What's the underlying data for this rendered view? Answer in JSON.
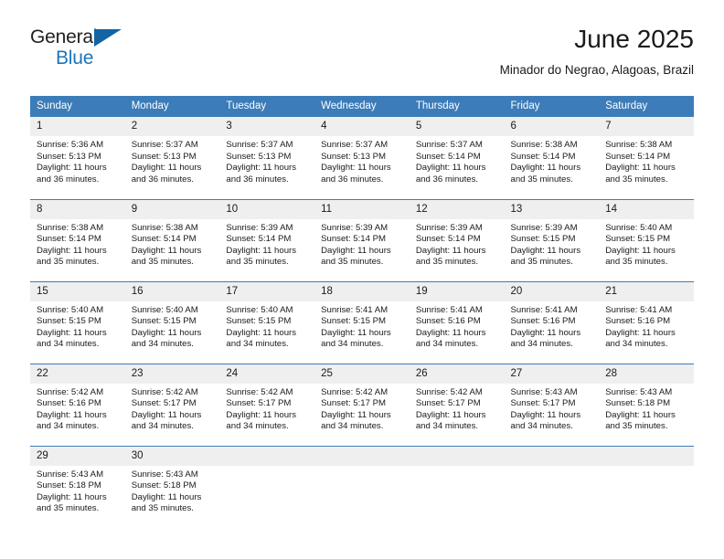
{
  "brand": {
    "line1": "General",
    "line2": "Blue",
    "triangle_color": "#1264a4",
    "blue_text_color": "#1b75bc"
  },
  "header": {
    "title": "June 2025",
    "subtitle": "Minador do Negrao, Alagoas, Brazil",
    "accent_color": "#3c7cb8",
    "daynum_bg": "#efefef"
  },
  "weekday_headers": [
    "Sunday",
    "Monday",
    "Tuesday",
    "Wednesday",
    "Thursday",
    "Friday",
    "Saturday"
  ],
  "weeks": [
    [
      {
        "day": "1",
        "sunrise": "Sunrise: 5:36 AM",
        "sunset": "Sunset: 5:13 PM",
        "daylight_l1": "Daylight: 11 hours",
        "daylight_l2": "and 36 minutes."
      },
      {
        "day": "2",
        "sunrise": "Sunrise: 5:37 AM",
        "sunset": "Sunset: 5:13 PM",
        "daylight_l1": "Daylight: 11 hours",
        "daylight_l2": "and 36 minutes."
      },
      {
        "day": "3",
        "sunrise": "Sunrise: 5:37 AM",
        "sunset": "Sunset: 5:13 PM",
        "daylight_l1": "Daylight: 11 hours",
        "daylight_l2": "and 36 minutes."
      },
      {
        "day": "4",
        "sunrise": "Sunrise: 5:37 AM",
        "sunset": "Sunset: 5:13 PM",
        "daylight_l1": "Daylight: 11 hours",
        "daylight_l2": "and 36 minutes."
      },
      {
        "day": "5",
        "sunrise": "Sunrise: 5:37 AM",
        "sunset": "Sunset: 5:14 PM",
        "daylight_l1": "Daylight: 11 hours",
        "daylight_l2": "and 36 minutes."
      },
      {
        "day": "6",
        "sunrise": "Sunrise: 5:38 AM",
        "sunset": "Sunset: 5:14 PM",
        "daylight_l1": "Daylight: 11 hours",
        "daylight_l2": "and 35 minutes."
      },
      {
        "day": "7",
        "sunrise": "Sunrise: 5:38 AM",
        "sunset": "Sunset: 5:14 PM",
        "daylight_l1": "Daylight: 11 hours",
        "daylight_l2": "and 35 minutes."
      }
    ],
    [
      {
        "day": "8",
        "sunrise": "Sunrise: 5:38 AM",
        "sunset": "Sunset: 5:14 PM",
        "daylight_l1": "Daylight: 11 hours",
        "daylight_l2": "and 35 minutes."
      },
      {
        "day": "9",
        "sunrise": "Sunrise: 5:38 AM",
        "sunset": "Sunset: 5:14 PM",
        "daylight_l1": "Daylight: 11 hours",
        "daylight_l2": "and 35 minutes."
      },
      {
        "day": "10",
        "sunrise": "Sunrise: 5:39 AM",
        "sunset": "Sunset: 5:14 PM",
        "daylight_l1": "Daylight: 11 hours",
        "daylight_l2": "and 35 minutes."
      },
      {
        "day": "11",
        "sunrise": "Sunrise: 5:39 AM",
        "sunset": "Sunset: 5:14 PM",
        "daylight_l1": "Daylight: 11 hours",
        "daylight_l2": "and 35 minutes."
      },
      {
        "day": "12",
        "sunrise": "Sunrise: 5:39 AM",
        "sunset": "Sunset: 5:14 PM",
        "daylight_l1": "Daylight: 11 hours",
        "daylight_l2": "and 35 minutes."
      },
      {
        "day": "13",
        "sunrise": "Sunrise: 5:39 AM",
        "sunset": "Sunset: 5:15 PM",
        "daylight_l1": "Daylight: 11 hours",
        "daylight_l2": "and 35 minutes."
      },
      {
        "day": "14",
        "sunrise": "Sunrise: 5:40 AM",
        "sunset": "Sunset: 5:15 PM",
        "daylight_l1": "Daylight: 11 hours",
        "daylight_l2": "and 35 minutes."
      }
    ],
    [
      {
        "day": "15",
        "sunrise": "Sunrise: 5:40 AM",
        "sunset": "Sunset: 5:15 PM",
        "daylight_l1": "Daylight: 11 hours",
        "daylight_l2": "and 34 minutes."
      },
      {
        "day": "16",
        "sunrise": "Sunrise: 5:40 AM",
        "sunset": "Sunset: 5:15 PM",
        "daylight_l1": "Daylight: 11 hours",
        "daylight_l2": "and 34 minutes."
      },
      {
        "day": "17",
        "sunrise": "Sunrise: 5:40 AM",
        "sunset": "Sunset: 5:15 PM",
        "daylight_l1": "Daylight: 11 hours",
        "daylight_l2": "and 34 minutes."
      },
      {
        "day": "18",
        "sunrise": "Sunrise: 5:41 AM",
        "sunset": "Sunset: 5:15 PM",
        "daylight_l1": "Daylight: 11 hours",
        "daylight_l2": "and 34 minutes."
      },
      {
        "day": "19",
        "sunrise": "Sunrise: 5:41 AM",
        "sunset": "Sunset: 5:16 PM",
        "daylight_l1": "Daylight: 11 hours",
        "daylight_l2": "and 34 minutes."
      },
      {
        "day": "20",
        "sunrise": "Sunrise: 5:41 AM",
        "sunset": "Sunset: 5:16 PM",
        "daylight_l1": "Daylight: 11 hours",
        "daylight_l2": "and 34 minutes."
      },
      {
        "day": "21",
        "sunrise": "Sunrise: 5:41 AM",
        "sunset": "Sunset: 5:16 PM",
        "daylight_l1": "Daylight: 11 hours",
        "daylight_l2": "and 34 minutes."
      }
    ],
    [
      {
        "day": "22",
        "sunrise": "Sunrise: 5:42 AM",
        "sunset": "Sunset: 5:16 PM",
        "daylight_l1": "Daylight: 11 hours",
        "daylight_l2": "and 34 minutes."
      },
      {
        "day": "23",
        "sunrise": "Sunrise: 5:42 AM",
        "sunset": "Sunset: 5:17 PM",
        "daylight_l1": "Daylight: 11 hours",
        "daylight_l2": "and 34 minutes."
      },
      {
        "day": "24",
        "sunrise": "Sunrise: 5:42 AM",
        "sunset": "Sunset: 5:17 PM",
        "daylight_l1": "Daylight: 11 hours",
        "daylight_l2": "and 34 minutes."
      },
      {
        "day": "25",
        "sunrise": "Sunrise: 5:42 AM",
        "sunset": "Sunset: 5:17 PM",
        "daylight_l1": "Daylight: 11 hours",
        "daylight_l2": "and 34 minutes."
      },
      {
        "day": "26",
        "sunrise": "Sunrise: 5:42 AM",
        "sunset": "Sunset: 5:17 PM",
        "daylight_l1": "Daylight: 11 hours",
        "daylight_l2": "and 34 minutes."
      },
      {
        "day": "27",
        "sunrise": "Sunrise: 5:43 AM",
        "sunset": "Sunset: 5:17 PM",
        "daylight_l1": "Daylight: 11 hours",
        "daylight_l2": "and 34 minutes."
      },
      {
        "day": "28",
        "sunrise": "Sunrise: 5:43 AM",
        "sunset": "Sunset: 5:18 PM",
        "daylight_l1": "Daylight: 11 hours",
        "daylight_l2": "and 35 minutes."
      }
    ],
    [
      {
        "day": "29",
        "sunrise": "Sunrise: 5:43 AM",
        "sunset": "Sunset: 5:18 PM",
        "daylight_l1": "Daylight: 11 hours",
        "daylight_l2": "and 35 minutes."
      },
      {
        "day": "30",
        "sunrise": "Sunrise: 5:43 AM",
        "sunset": "Sunset: 5:18 PM",
        "daylight_l1": "Daylight: 11 hours",
        "daylight_l2": "and 35 minutes."
      },
      {
        "day": "",
        "sunrise": "",
        "sunset": "",
        "daylight_l1": "",
        "daylight_l2": ""
      },
      {
        "day": "",
        "sunrise": "",
        "sunset": "",
        "daylight_l1": "",
        "daylight_l2": ""
      },
      {
        "day": "",
        "sunrise": "",
        "sunset": "",
        "daylight_l1": "",
        "daylight_l2": ""
      },
      {
        "day": "",
        "sunrise": "",
        "sunset": "",
        "daylight_l1": "",
        "daylight_l2": ""
      },
      {
        "day": "",
        "sunrise": "",
        "sunset": "",
        "daylight_l1": "",
        "daylight_l2": ""
      }
    ]
  ]
}
